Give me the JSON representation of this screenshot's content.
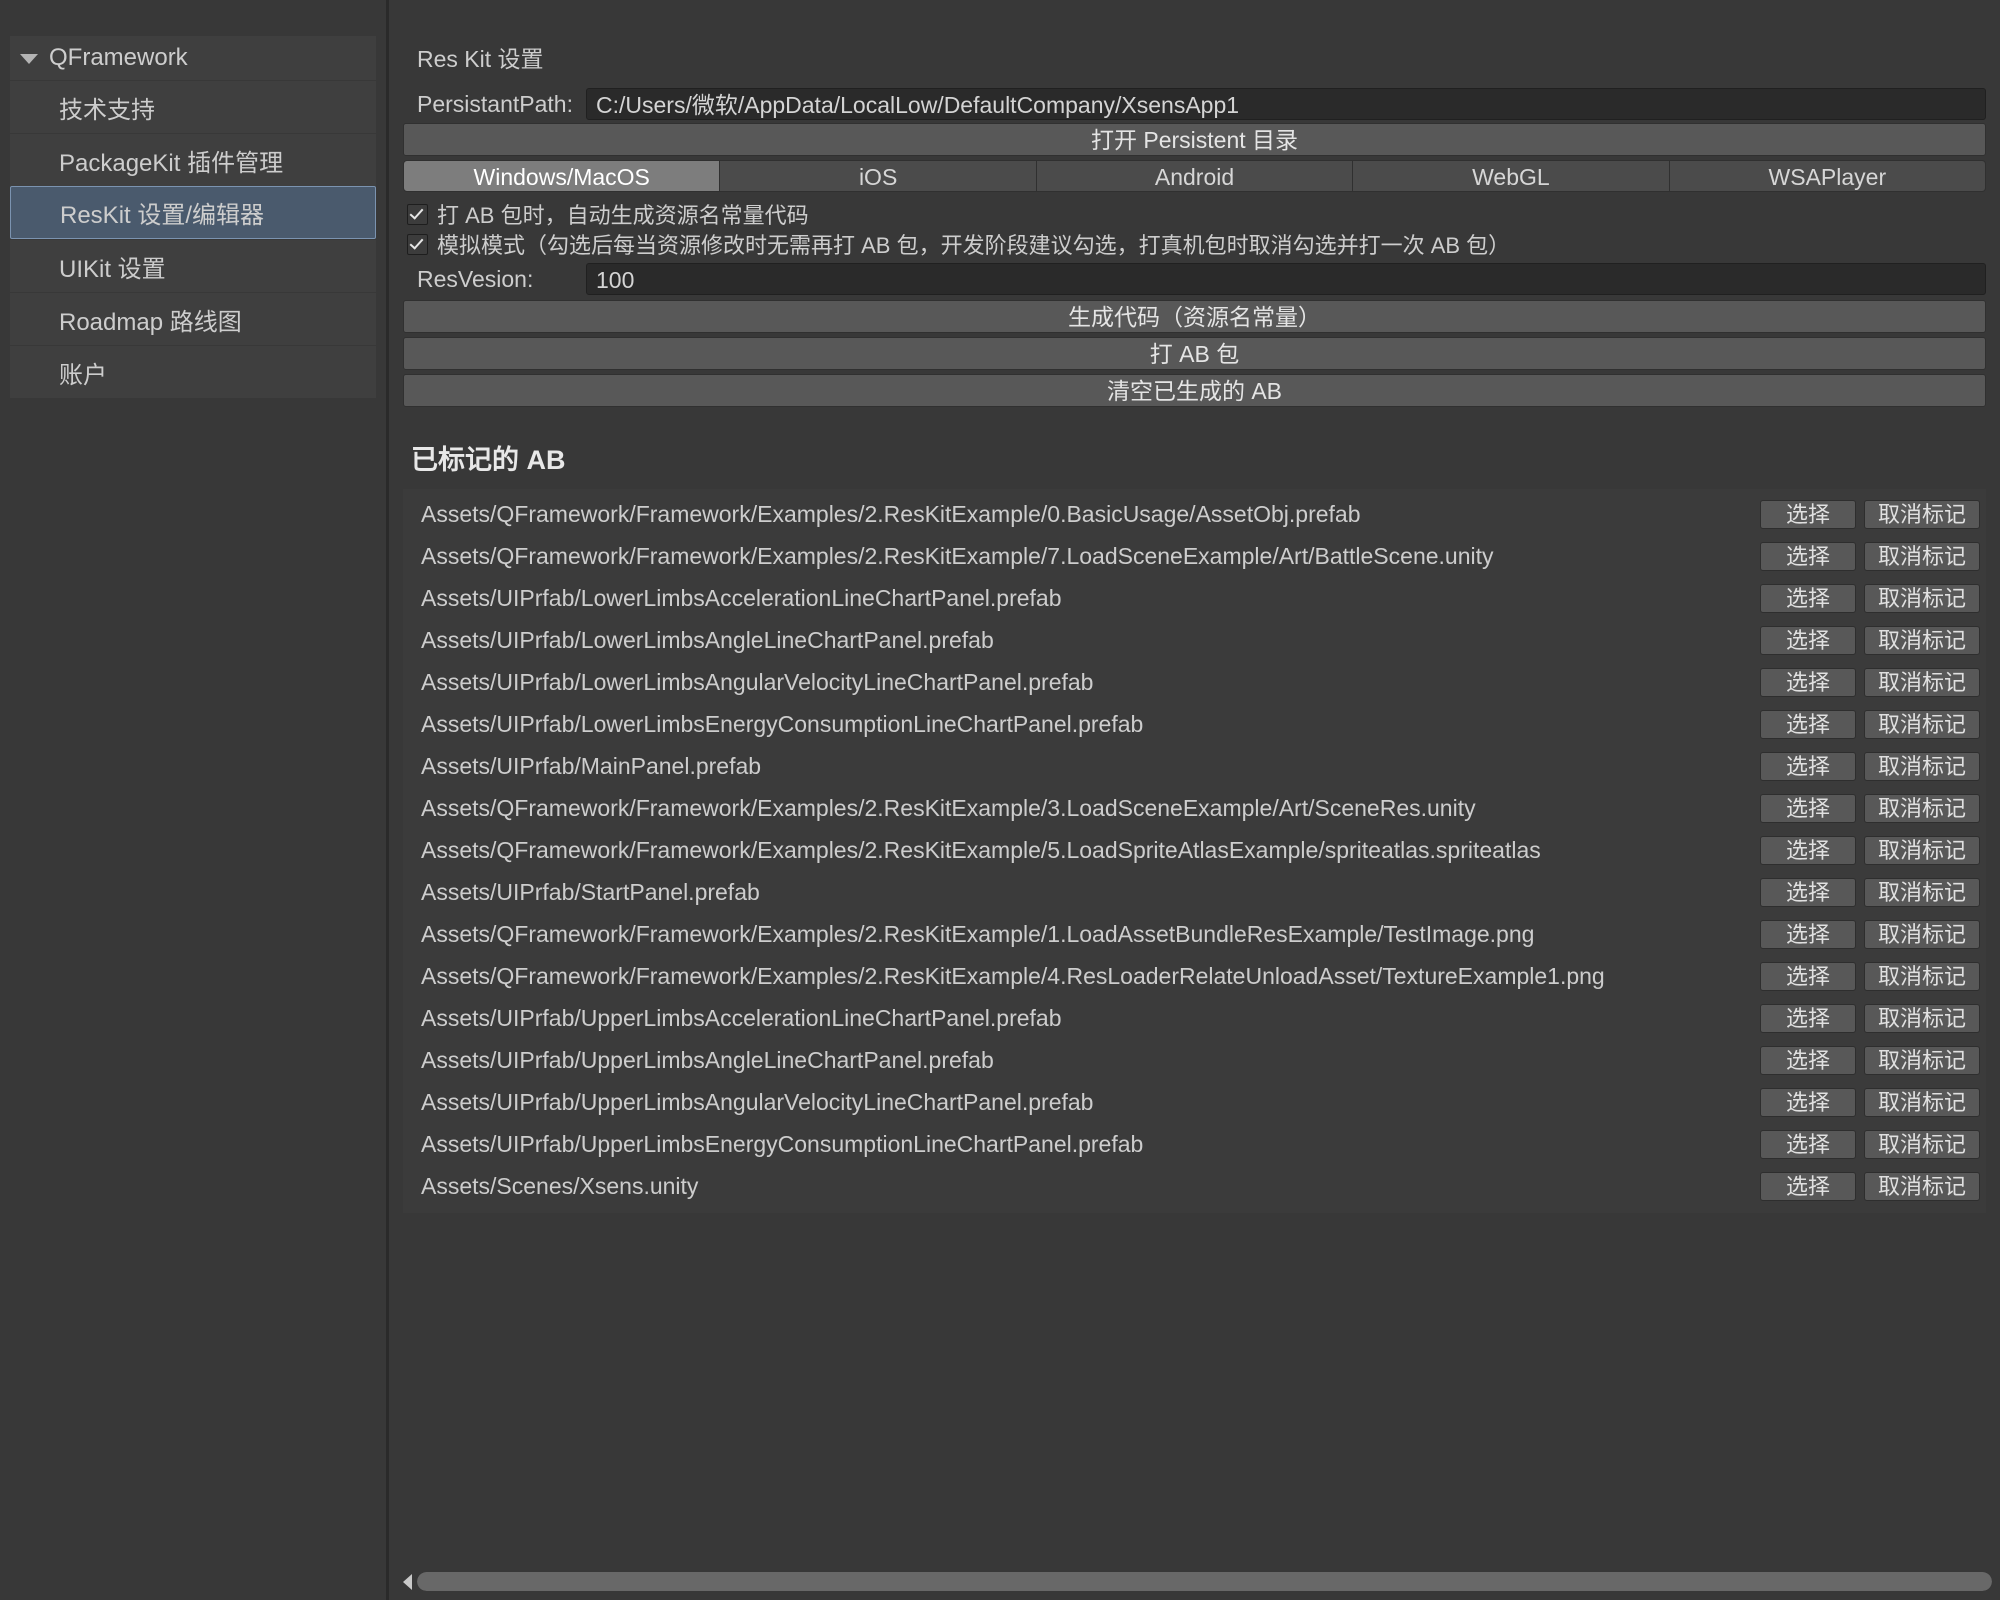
{
  "sidebar": {
    "root_label": "QFramework",
    "items": [
      {
        "label": "技术支持",
        "selected": false
      },
      {
        "label": "PackageKit 插件管理",
        "selected": false
      },
      {
        "label": "ResKit 设置/编辑器",
        "selected": true
      },
      {
        "label": "UIKit 设置",
        "selected": false
      },
      {
        "label": "Roadmap 路线图",
        "selected": false
      },
      {
        "label": "账户",
        "selected": false
      }
    ]
  },
  "panel": {
    "title": "Res Kit 设置",
    "persistant_path_label": "PersistantPath:",
    "persistant_path_value": "C:/Users/微软/AppData/LocalLow/DefaultCompany/XsensApp1",
    "open_persistent_button": "打开 Persistent 目录",
    "platform_tabs": [
      {
        "label": "Windows/MacOS",
        "active": true
      },
      {
        "label": "iOS",
        "active": false
      },
      {
        "label": "Android",
        "active": false
      },
      {
        "label": "WebGL",
        "active": false
      },
      {
        "label": "WSAPlayer",
        "active": false
      }
    ],
    "checkboxes": [
      {
        "label": "打 AB 包时，自动生成资源名常量代码",
        "checked": true
      },
      {
        "label": "模拟模式（勾选后每当资源修改时无需再打 AB 包，开发阶段建议勾选，打真机包时取消勾选并打一次 AB 包）",
        "checked": true
      }
    ],
    "res_version_label": "ResVesion:",
    "res_version_value": "100",
    "action_buttons": [
      "生成代码（资源名常量）",
      "打 AB 包",
      "清空已生成的 AB"
    ],
    "marked_ab_heading": "已标记的 AB",
    "row_select_label": "选择",
    "row_unmark_label": "取消标记",
    "marked_assets": [
      "Assets/QFramework/Framework/Examples/2.ResKitExample/0.BasicUsage/AssetObj.prefab",
      "Assets/QFramework/Framework/Examples/2.ResKitExample/7.LoadSceneExample/Art/BattleScene.unity",
      "Assets/UIPrfab/LowerLimbsAccelerationLineChartPanel.prefab",
      "Assets/UIPrfab/LowerLimbsAngleLineChartPanel.prefab",
      "Assets/UIPrfab/LowerLimbsAngularVelocityLineChartPanel.prefab",
      "Assets/UIPrfab/LowerLimbsEnergyConsumptionLineChartPanel.prefab",
      "Assets/UIPrfab/MainPanel.prefab",
      "Assets/QFramework/Framework/Examples/2.ResKitExample/3.LoadSceneExample/Art/SceneRes.unity",
      "Assets/QFramework/Framework/Examples/2.ResKitExample/5.LoadSpriteAtlasExample/spriteatlas.spriteatlas",
      "Assets/UIPrfab/StartPanel.prefab",
      "Assets/QFramework/Framework/Examples/2.ResKitExample/1.LoadAssetBundleResExample/TestImage.png",
      "Assets/QFramework/Framework/Examples/2.ResKitExample/4.ResLoaderRelateUnloadAsset/TextureExample1.png",
      "Assets/UIPrfab/UpperLimbsAccelerationLineChartPanel.prefab",
      "Assets/UIPrfab/UpperLimbsAngleLineChartPanel.prefab",
      "Assets/UIPrfab/UpperLimbsAngularVelocityLineChartPanel.prefab",
      "Assets/UIPrfab/UpperLimbsEnergyConsumptionLineChartPanel.prefab",
      "Assets/Scenes/Xsens.unity"
    ]
  },
  "colors": {
    "background": "#383838",
    "selection": "#4a5a6d",
    "selection_border": "#7b93b0",
    "button": "#585858",
    "field": "#2a2a2a"
  }
}
